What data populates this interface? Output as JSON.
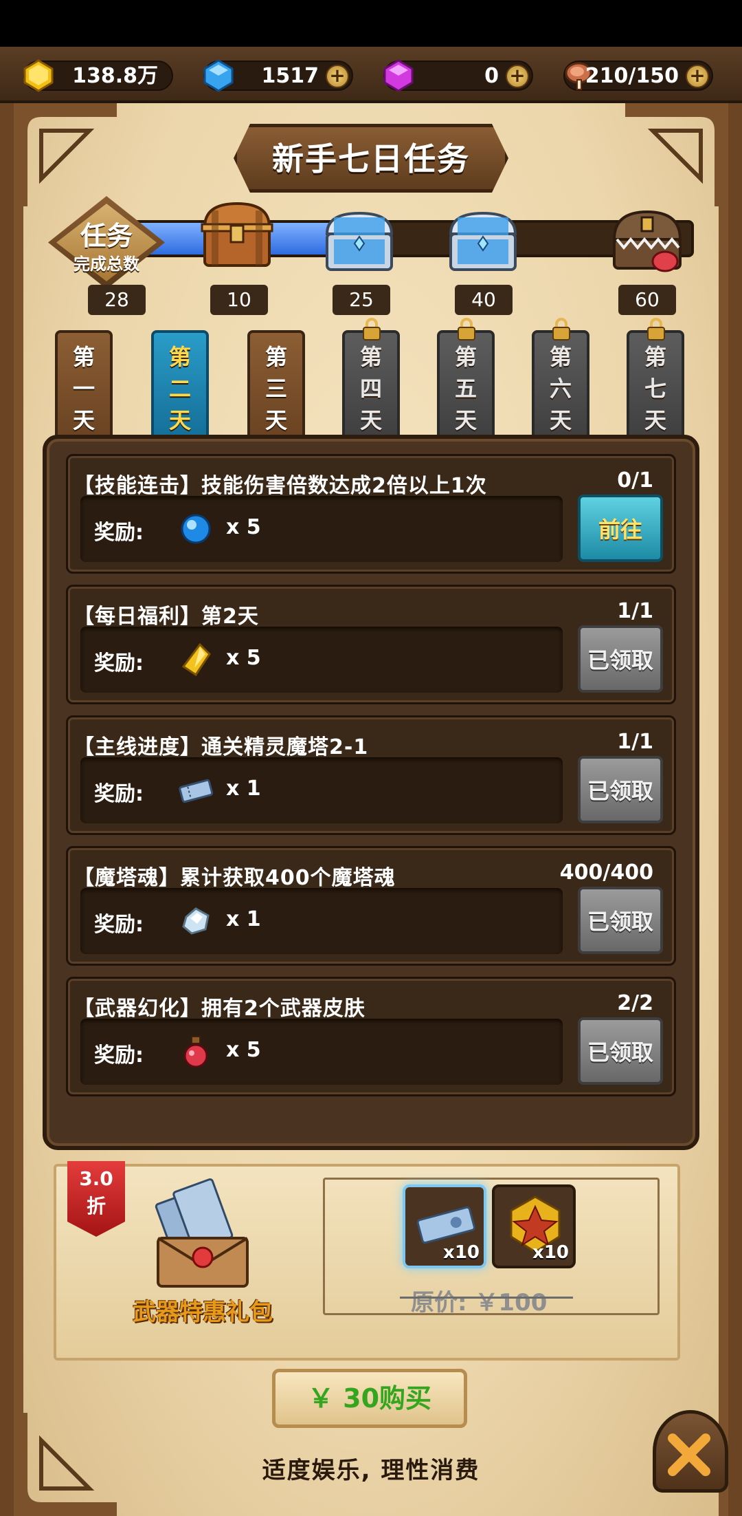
{
  "resources": {
    "gold": "138.8万",
    "diamond": "1517",
    "gem": "0",
    "stamina": "210/150"
  },
  "title": "新手七日任务",
  "progress": {
    "label_main": "任务",
    "label_sub": "完成总数",
    "completed": "28",
    "milestones": [
      "10",
      "25",
      "40",
      "60"
    ],
    "fill_fraction": 0.45
  },
  "days": [
    {
      "c1": "第",
      "c2": "一",
      "c3": "天",
      "state": "normal"
    },
    {
      "c1": "第",
      "c2": "二",
      "c3": "天",
      "state": "active"
    },
    {
      "c1": "第",
      "c2": "三",
      "c3": "天",
      "state": "normal"
    },
    {
      "c1": "第",
      "c2": "四",
      "c3": "天",
      "state": "locked"
    },
    {
      "c1": "第",
      "c2": "五",
      "c3": "天",
      "state": "locked"
    },
    {
      "c1": "第",
      "c2": "六",
      "c3": "天",
      "state": "locked"
    },
    {
      "c1": "第",
      "c2": "七",
      "c3": "天",
      "state": "locked"
    }
  ],
  "tasks": [
    {
      "title": "【技能连击】技能伤害倍数达成2倍以上1次",
      "progress": "0/1",
      "reward_label": "奖励:",
      "reward_qty": "x 5",
      "reward_icon": "blue-orb-icon",
      "button": "前往",
      "button_state": "go"
    },
    {
      "title": "【每日福利】第2天",
      "progress": "1/1",
      "reward_label": "奖励:",
      "reward_qty": "x 5",
      "reward_icon": "gold-crystal-icon",
      "button": "已领取",
      "button_state": "done"
    },
    {
      "title": "【主线进度】通关精灵魔塔2-1",
      "progress": "1/1",
      "reward_label": "奖励:",
      "reward_qty": "x 1",
      "reward_icon": "ticket-icon",
      "button": "已领取",
      "button_state": "done"
    },
    {
      "title": "【魔塔魂】累计获取400个魔塔魂",
      "progress": "400/400",
      "reward_label": "奖励:",
      "reward_qty": "x 1",
      "reward_icon": "soul-crystal-icon",
      "button": "已领取",
      "button_state": "done"
    },
    {
      "title": "【武器幻化】拥有2个武器皮肤",
      "progress": "2/2",
      "reward_label": "奖励:",
      "reward_qty": "x 5",
      "reward_icon": "potion-icon",
      "button": "已领取",
      "button_state": "done"
    }
  ],
  "gift": {
    "discount": "3.0\n折",
    "discount_l1": "3.0",
    "discount_l2": "折",
    "name": "武器特惠礼包",
    "items": [
      {
        "icon": "weapon-ticket-icon",
        "qty": "x10"
      },
      {
        "icon": "gold-emblem-icon",
        "qty": "x10"
      }
    ],
    "original_price": "原价: ￥100",
    "buy_label": "￥ 30购买"
  },
  "disclaimer": "适度娱乐, 理性消费",
  "colors": {
    "accent_blue": "#2e6be0",
    "buy_green": "#35a51f",
    "discount_red": "#c42424"
  }
}
